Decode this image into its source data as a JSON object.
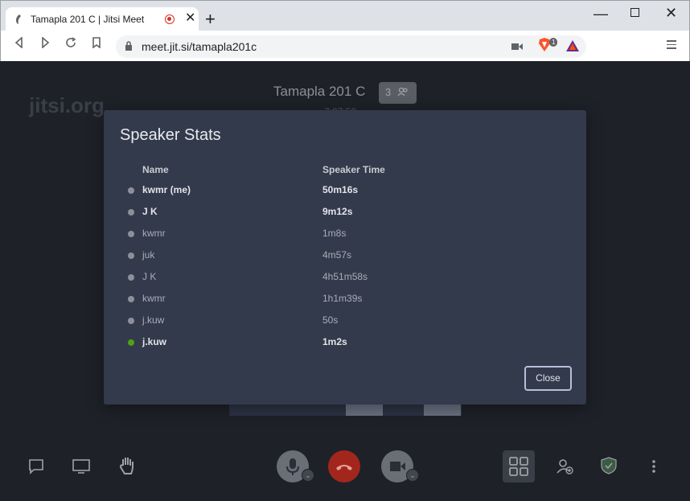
{
  "browser": {
    "tab_title": "Tamapla 201 C | Jitsi Meet",
    "url": "meet.jit.si/tamapla201c",
    "brave_badge": "1"
  },
  "meeting": {
    "title": "Tamapla 201 C",
    "participant_count": "3",
    "timer": "7:07:58",
    "watermark": "jitsi.org"
  },
  "dialog": {
    "title": "Speaker Stats",
    "col_name": "Name",
    "col_time": "Speaker Time",
    "rows": [
      {
        "name": "kwmr (me)",
        "time": "50m16s",
        "bold": true,
        "active": false
      },
      {
        "name": "J K",
        "time": "9m12s",
        "bold": true,
        "active": false
      },
      {
        "name": "kwmr",
        "time": "1m8s",
        "bold": false,
        "active": false
      },
      {
        "name": "juk",
        "time": "4m57s",
        "bold": false,
        "active": false
      },
      {
        "name": "J K",
        "time": "4h51m58s",
        "bold": false,
        "active": false
      },
      {
        "name": "kwmr",
        "time": "1h1m39s",
        "bold": false,
        "active": false
      },
      {
        "name": "j.kuw",
        "time": "50s",
        "bold": false,
        "active": false
      },
      {
        "name": "j.kuw",
        "time": "1m2s",
        "bold": true,
        "active": true
      }
    ],
    "close_label": "Close"
  },
  "colors": {
    "active_dot": "#52a013",
    "hangup": "#a3261d",
    "dialog_bg": "#333a4c"
  },
  "icons": [
    "chat-icon",
    "screenshare-icon",
    "raise-hand-icon",
    "microphone-icon",
    "hangup-icon",
    "camera-icon",
    "tile-view-icon",
    "invite-icon",
    "security-shield-icon",
    "more-options-icon"
  ]
}
